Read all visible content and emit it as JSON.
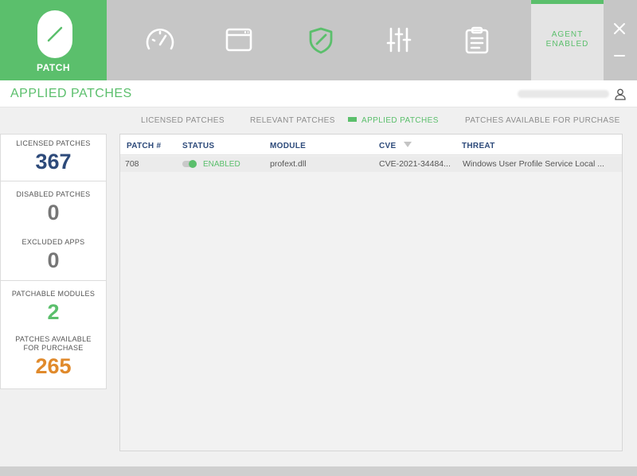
{
  "nav": {
    "brand_label": "PATCH",
    "icons": [
      "gauge-icon",
      "browser-window-icon",
      "shield-icon",
      "sliders-icon",
      "clipboard-icon"
    ],
    "agent_status_line1": "AGENT",
    "agent_status_line2": "ENABLED"
  },
  "header": {
    "title": "APPLIED PATCHES"
  },
  "tabs": [
    {
      "label": "LICENSED PATCHES",
      "active": false
    },
    {
      "label": "RELEVANT PATCHES",
      "active": false
    },
    {
      "label": "APPLIED PATCHES",
      "active": true
    },
    {
      "label": "PATCHES AVAILABLE FOR PURCHASE",
      "active": false
    }
  ],
  "stats": {
    "licensed": {
      "label": "LICENSED PATCHES",
      "value": "367"
    },
    "disabled": {
      "label": "DISABLED PATCHES",
      "value": "0"
    },
    "excluded": {
      "label": "EXCLUDED APPS",
      "value": "0"
    },
    "patchable": {
      "label": "PATCHABLE MODULES",
      "value": "2"
    },
    "available_line1": "PATCHES AVAILABLE",
    "available_line2": "FOR PURCHASE",
    "available_value": "265"
  },
  "table": {
    "columns": [
      "PATCH #",
      "STATUS",
      "MODULE",
      "CVE",
      "THREAT"
    ],
    "rows": [
      {
        "patch": "708",
        "status": "ENABLED",
        "module": "profext.dll",
        "cve": "CVE-2021-34484...",
        "threat": "Windows User Profile Service Local ..."
      }
    ]
  },
  "colors": {
    "accent_green": "#5bbf6c",
    "navy": "#2d4a7a",
    "orange": "#e08a2c",
    "gray_value": "#777777"
  }
}
